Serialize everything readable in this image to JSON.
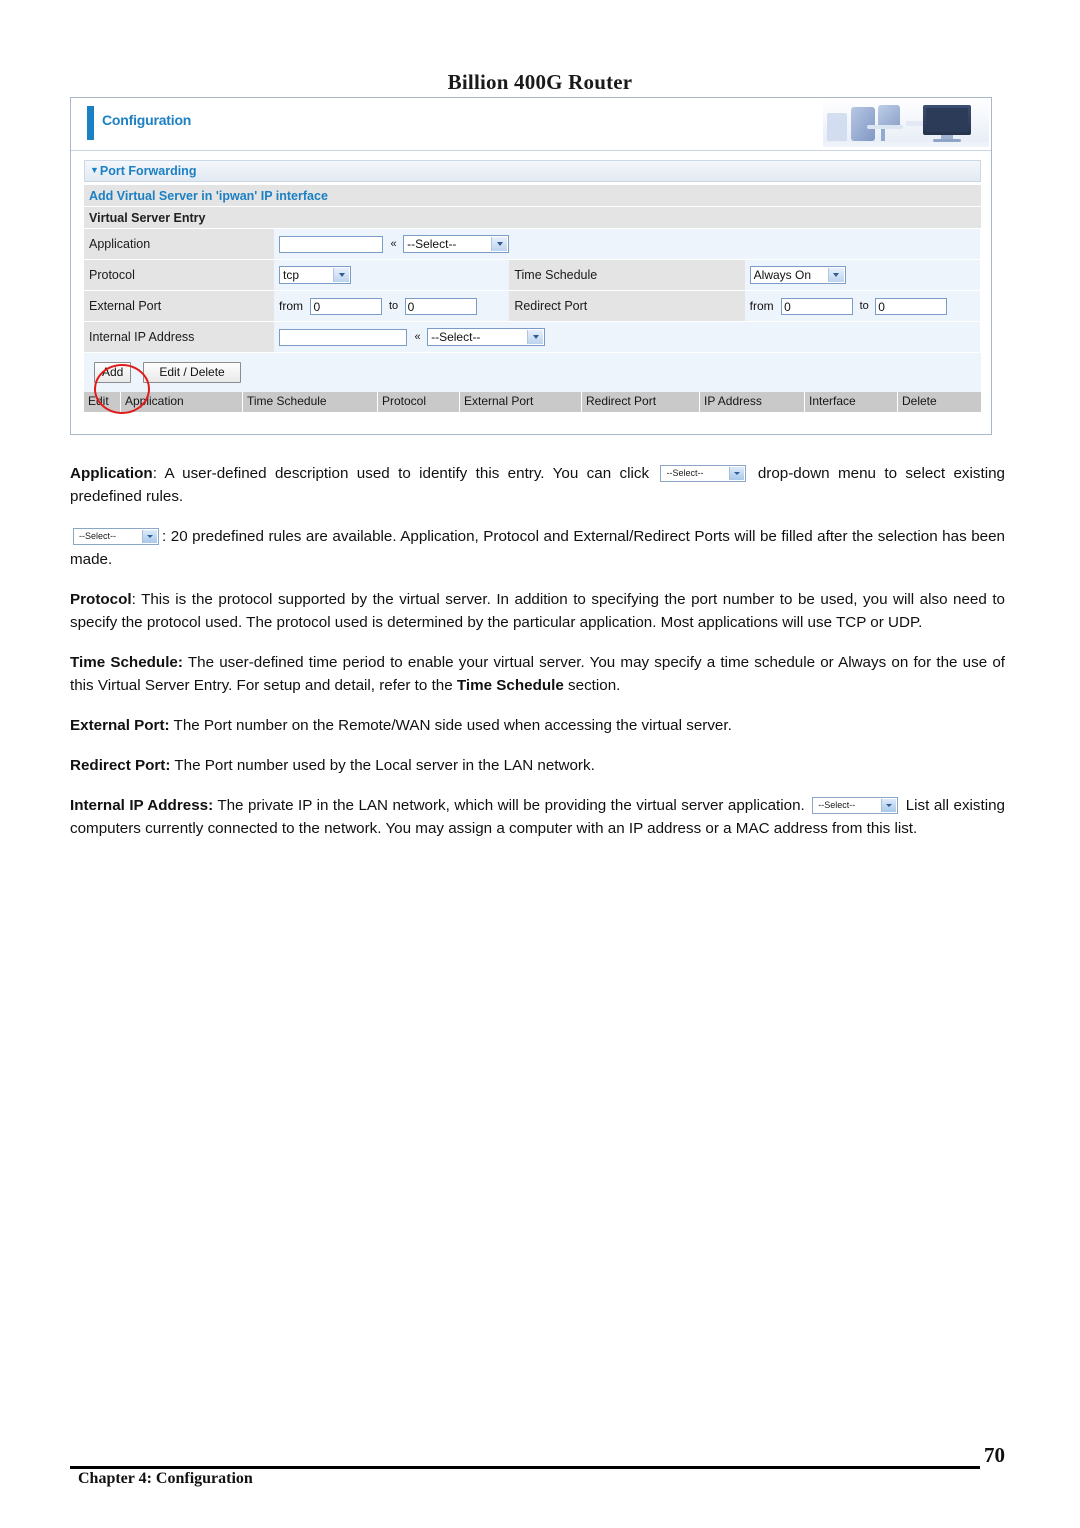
{
  "document": {
    "header_title": "Billion 400G Router",
    "footer_chapter": "Chapter 4: Configuration",
    "page_number": "70"
  },
  "router_ui": {
    "header": {
      "title": "Configuration",
      "banner_image_alt": "office-desk-photo"
    },
    "section_bar": {
      "caret": "▼",
      "label": "Port Forwarding"
    },
    "subsection_bar": {
      "label": "Add Virtual Server in 'ipwan' IP interface"
    },
    "group_bar": {
      "label": "Virtual Server Entry"
    },
    "form": {
      "application": {
        "label": "Application",
        "text_value": "",
        "chevrons": "«",
        "select_value": "--Select--"
      },
      "protocol": {
        "label": "Protocol",
        "select_value": "tcp"
      },
      "time_schedule": {
        "label": "Time Schedule",
        "select_value": "Always On"
      },
      "external_port": {
        "label": "External Port",
        "from_label": "from",
        "from_value": "0",
        "to_label": "to",
        "to_value": "0"
      },
      "redirect_port": {
        "label": "Redirect Port",
        "from_label": "from",
        "from_value": "0",
        "to_label": "to",
        "to_value": "0"
      },
      "internal_ip": {
        "label": "Internal IP Address",
        "text_value": "",
        "chevrons": "«",
        "select_value": "--Select--"
      }
    },
    "buttons": {
      "add": "Add",
      "edit_delete": "Edit / Delete"
    },
    "results_table": {
      "columns": [
        "Edit",
        "Application",
        "Time Schedule",
        "Protocol",
        "External Port",
        "Redirect Port",
        "IP Address",
        "Interface",
        "Delete"
      ]
    },
    "annotation": {
      "highlight_target": "Add",
      "color": "#e01b1b"
    }
  },
  "prose": {
    "select_glyph_label": "--Select--",
    "p1_term": "Application",
    "p1_a": ": A user-defined description used to identify this entry. You can click",
    "p1_b": "drop-down menu to select existing predefined rules.",
    "p2_a": ": 20 predefined rules are available.   Application, Protocol and External/Redirect Ports will be filled after the selection has been made.",
    "p3_term": "Protocol",
    "p3_a": ": This is the protocol supported by the virtual server. In addition to specifying the port number to be used, you will also need to specify the protocol used. The protocol used is determined by the particular application. Most applications will use TCP or UDP.",
    "p4_term": "Time Schedule:",
    "p4_a": " The user-defined time period to enable your virtual server. You may specify a time schedule or Always on for the use of this Virtual Server Entry. For setup and detail, refer to the ",
    "p4_bold": "Time Schedule",
    "p4_b": " section.",
    "p5_term": "External Port:",
    "p5_a": " The Port number on the Remote/WAN side used when accessing the virtual server.",
    "p6_term": "Redirect Port:",
    "p6_a": " The Port number used by the Local server in the LAN network.",
    "p7_term": "Internal IP Address:",
    "p7_a": " The private IP in the LAN network, which will be providing the virtual server application.",
    "p7_b": "List all existing computers currently connected to the network. You may assign a computer with an IP address or a MAC address from this list."
  }
}
